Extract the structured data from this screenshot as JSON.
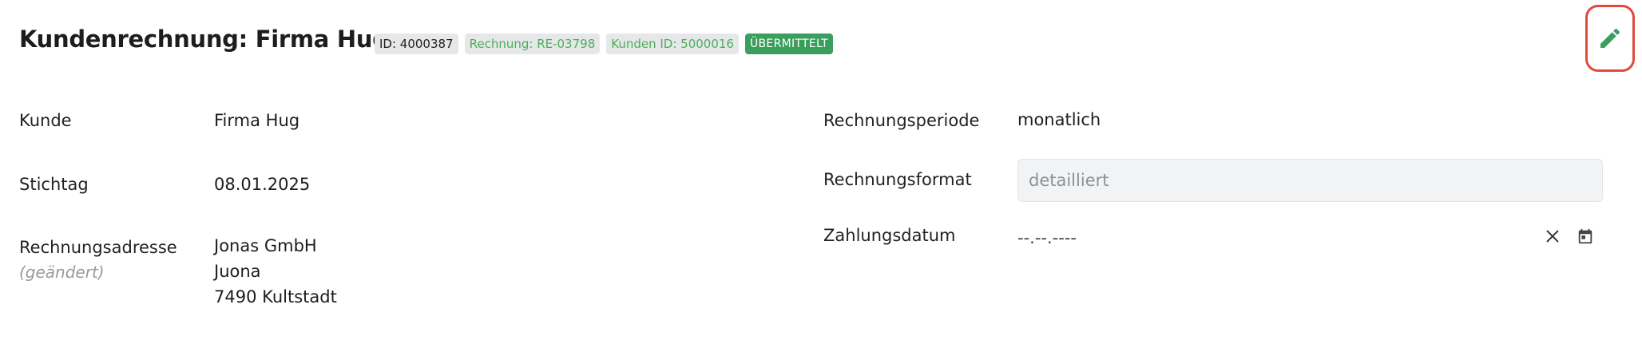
{
  "header": {
    "title": "Kundenrechnung: Firma Hug",
    "badges": {
      "id": "ID: 4000387",
      "invoice": "Rechnung: RE-03798",
      "customer": "Kunden ID: 5000016",
      "status": "ÜBERMITTELT"
    }
  },
  "left": {
    "customer_label": "Kunde",
    "customer_value": "Firma Hug",
    "date_label": "Stichtag",
    "date_value": "08.01.2025",
    "address_label": "Rechnungsadresse",
    "address_note": "(geändert)",
    "address_lines": [
      "Jonas GmbH",
      "Juona",
      "7490 Kultstadt"
    ]
  },
  "right": {
    "period_label": "Rechnungsperiode",
    "period_value": "monatlich",
    "format_label": "Rechnungsformat",
    "format_placeholder": "detailliert",
    "payment_label": "Zahlungsdatum",
    "payment_value": "--.--.----"
  },
  "icons": {
    "edit": "pencil-icon",
    "clear": "close-icon",
    "calendar": "calendar-icon"
  },
  "colors": {
    "accent_green": "#3a9e5c",
    "highlight_red": "#e04a3c"
  }
}
